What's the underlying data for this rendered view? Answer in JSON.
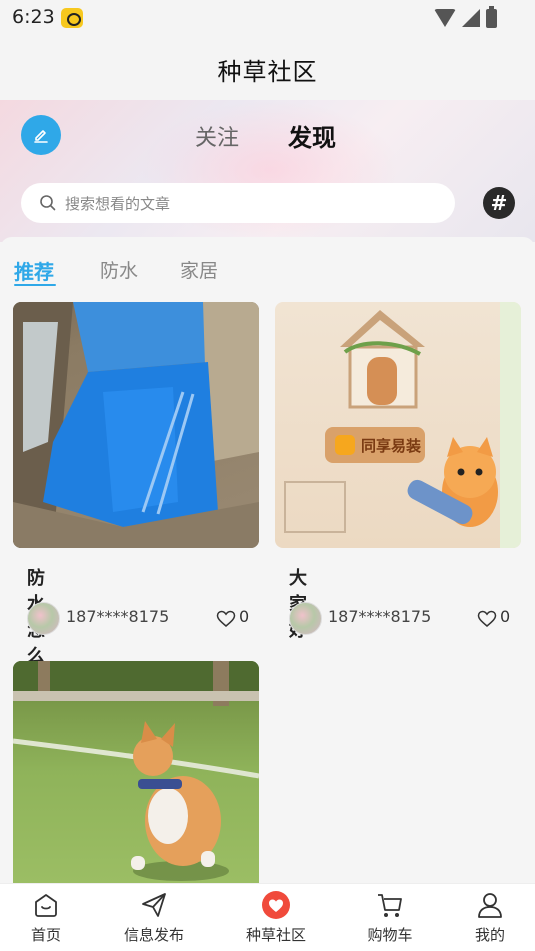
{
  "status_bar": {
    "time": "6:23"
  },
  "header": {
    "title": "种草社区"
  },
  "hero": {
    "tabs": [
      {
        "label": "关注"
      },
      {
        "label": "发现"
      }
    ],
    "search": {
      "placeholder": "搜索想看的文章"
    },
    "hashtag": "#"
  },
  "categories": [
    {
      "label": "推荐"
    },
    {
      "label": "防水"
    },
    {
      "label": "家居"
    }
  ],
  "posts": [
    {
      "title": "防水怎么才不会返水",
      "user": "187****8175",
      "likes": "0"
    },
    {
      "title": "大家好",
      "user": "187****8175",
      "likes": "0",
      "image_text": "同享易装"
    },
    {
      "title": "",
      "user": "",
      "likes": ""
    }
  ],
  "nav": [
    {
      "label": "首页",
      "icon": "home-icon"
    },
    {
      "label": "信息发布",
      "icon": "send-icon"
    },
    {
      "label": "种草社区",
      "icon": "heart-filled-icon"
    },
    {
      "label": "购物车",
      "icon": "cart-icon"
    },
    {
      "label": "我的",
      "icon": "person-icon"
    }
  ],
  "colors": {
    "accent": "#2fa8e8",
    "community_active": "#f04a3b"
  }
}
